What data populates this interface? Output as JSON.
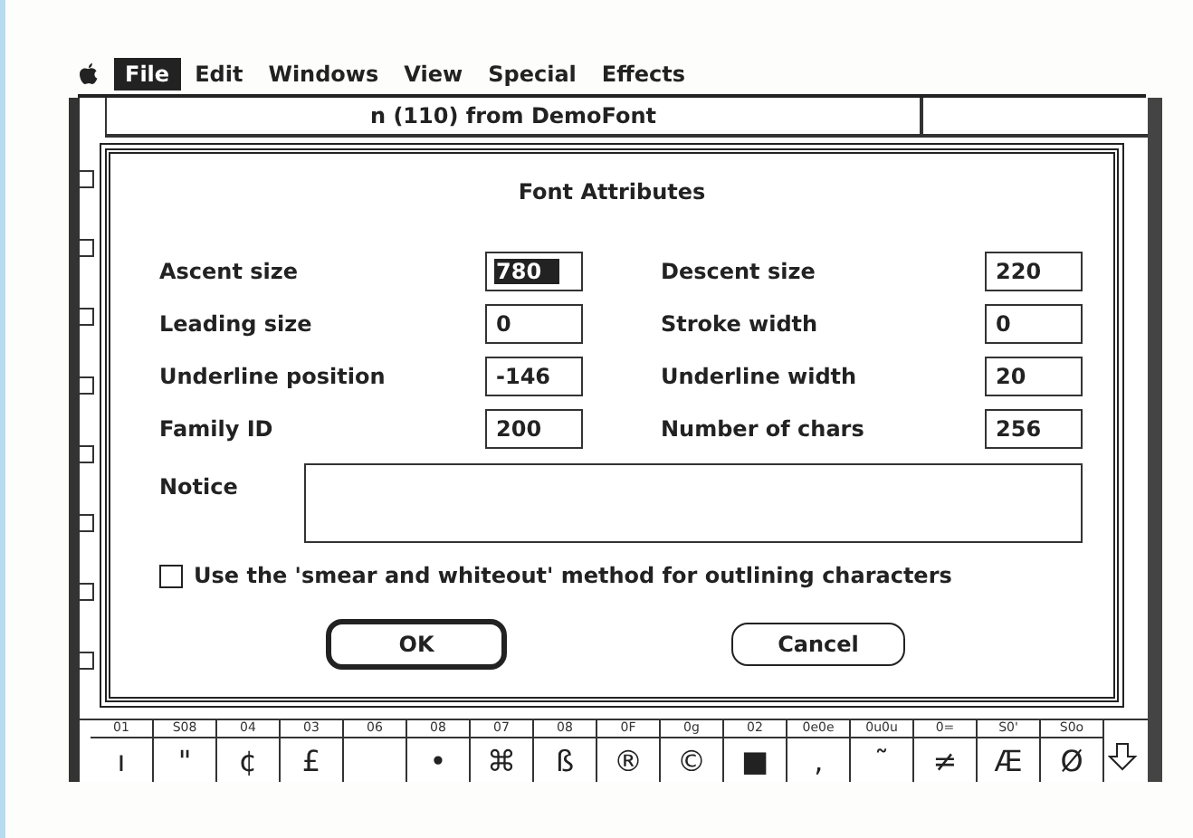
{
  "menu": [
    {
      "label": "File",
      "selected": true
    },
    {
      "label": "Edit",
      "selected": false
    },
    {
      "label": "Windows",
      "selected": false
    },
    {
      "label": "View",
      "selected": false
    },
    {
      "label": "Special",
      "selected": false
    },
    {
      "label": "Effects",
      "selected": false
    }
  ],
  "window": {
    "title": "n (110) from DemoFont"
  },
  "dialog": {
    "title": "Font Attributes",
    "fields": [
      {
        "label": "Ascent size",
        "value": "780",
        "selected": true
      },
      {
        "label": "Descent size",
        "value": "220",
        "selected": false
      },
      {
        "label": "Leading size",
        "value": "0",
        "selected": false
      },
      {
        "label": "Stroke width",
        "value": "0",
        "selected": false
      },
      {
        "label": "Underline position",
        "value": "-146",
        "selected": false
      },
      {
        "label": "Underline width",
        "value": "20",
        "selected": false
      },
      {
        "label": "Family ID",
        "value": "200",
        "selected": false
      },
      {
        "label": "Number of chars",
        "value": "256",
        "selected": false
      }
    ],
    "notice": {
      "label": "Notice"
    },
    "checkbox": {
      "label": "Use the 'smear and whiteout' method for outlining characters",
      "checked": false
    },
    "buttons": [
      {
        "label": "OK",
        "default": true
      },
      {
        "label": "Cancel",
        "default": false
      }
    ]
  },
  "glyph_table": [
    {
      "code": "01",
      "glyph": "ı"
    },
    {
      "code": "S08",
      "glyph": "\""
    },
    {
      "code": "04",
      "glyph": "¢"
    },
    {
      "code": "03",
      "glyph": "£"
    },
    {
      "code": "06"
    },
    {
      "code": "08",
      "glyph": "•"
    },
    {
      "code": "07",
      "glyph": "⌘"
    },
    {
      "code": "08",
      "glyph": "ß"
    },
    {
      "code": "0F",
      "glyph": "®"
    },
    {
      "code": "0g",
      "glyph": "©"
    },
    {
      "code": "02",
      "glyph": "■"
    },
    {
      "code": "0e0e",
      "glyph": "‚"
    },
    {
      "code": "0u0u",
      "glyph": "˜"
    },
    {
      "code": "0=",
      "glyph": "≠"
    },
    {
      "code": "S0'",
      "glyph": "Æ"
    },
    {
      "code": "S0o",
      "glyph": "Ø"
    }
  ]
}
